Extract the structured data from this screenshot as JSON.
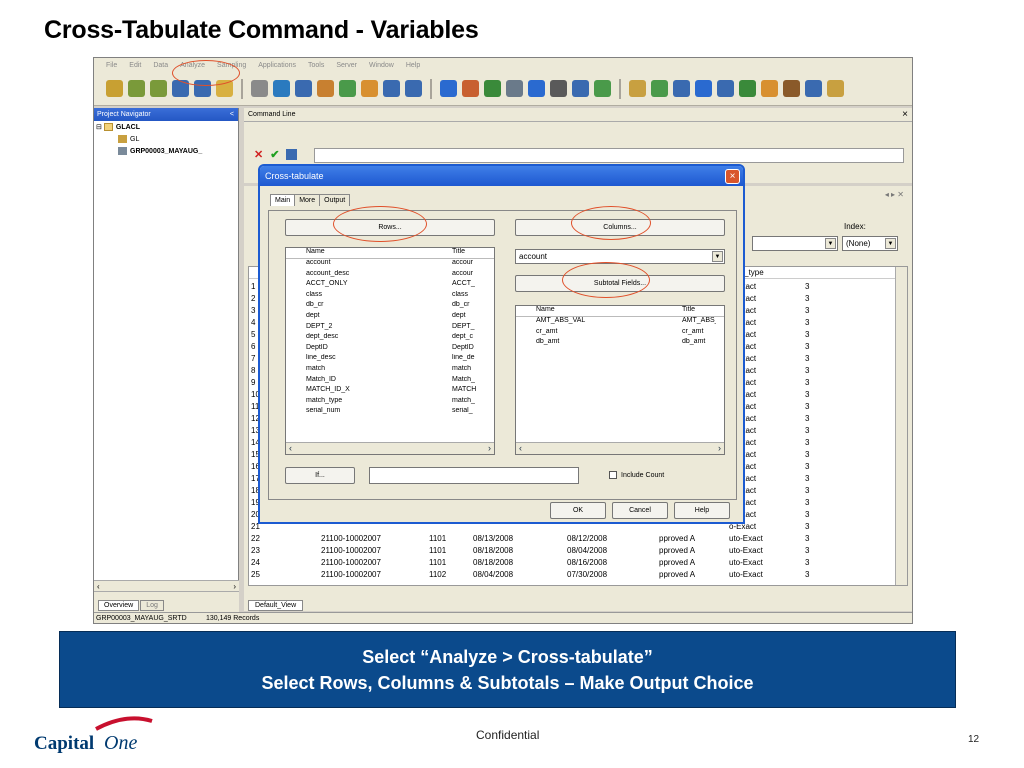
{
  "slide": {
    "title": "Cross-Tabulate Command - Variables",
    "caption_line1": "Select “Analyze > Cross-tabulate”",
    "caption_line2": "Select Rows, Columns & Subtotals – Make Output Choice",
    "confidential": "Confidential",
    "page_number": "12",
    "logo_text_capital": "Capital",
    "logo_text_one": "One",
    "highlight_color": "#e0502a",
    "banner_color": "#0b4a8c"
  },
  "app": {
    "menu": [
      "File",
      "Edit",
      "Data",
      "Analyze",
      "Sampling",
      "Applications",
      "Tools",
      "Server",
      "Window",
      "Help"
    ],
    "toolbar_colors": [
      "#c8a032",
      "#7a9a3a",
      "#7a9a3a",
      "#3a6ab0",
      "#3a6ab0",
      "#d8b040",
      "#8a8a8a",
      "#2a7abf",
      "#3a6ab0",
      "#c88030",
      "#4a9a4a",
      "#d89030",
      "#3a6ab0",
      "#3a6ab0",
      "#2a6ad0",
      "#c86030",
      "#3a8a3a",
      "#6a7a8a",
      "#2a6ad0",
      "#5a5a5a",
      "#3a6ab0",
      "#4a9a4a",
      "#c8a040",
      "#4a9a4a",
      "#3a6ab0",
      "#2a6ad0",
      "#3a6ab0",
      "#3a8a3a",
      "#d89030",
      "#8a5a2a",
      "#3a6ab0",
      "#c8a040"
    ],
    "nav": {
      "title": "Project Navigator",
      "close": "<",
      "tree": [
        "GLACL",
        "GL",
        "GRP00003_MAYAUG_"
      ],
      "tabs": [
        "Overview",
        "Log"
      ]
    },
    "command": {
      "title": "Command Line",
      "close": "×"
    },
    "view": {
      "index_label": "Index:",
      "index_value": "(None)",
      "header_match_type": "atch_type",
      "rows": [
        {
          "n": "1",
          "c1": "",
          "c2": "",
          "c3": "",
          "c4": "",
          "c5": "",
          "c6": "o-Exact",
          "c7": "3"
        },
        {
          "n": "2",
          "c1": "",
          "c2": "",
          "c3": "",
          "c4": "",
          "c5": "",
          "c6": "o-Exact",
          "c7": "3"
        },
        {
          "n": "3",
          "c1": "",
          "c2": "",
          "c3": "",
          "c4": "",
          "c5": "",
          "c6": "o-Exact",
          "c7": "3"
        },
        {
          "n": "4",
          "c1": "",
          "c2": "",
          "c3": "",
          "c4": "",
          "c5": "",
          "c6": "o-Exact",
          "c7": "3"
        },
        {
          "n": "5",
          "c1": "",
          "c2": "",
          "c3": "",
          "c4": "",
          "c5": "",
          "c6": "o-Exact",
          "c7": "3"
        },
        {
          "n": "6",
          "c1": "",
          "c2": "",
          "c3": "",
          "c4": "",
          "c5": "",
          "c6": "o-Exact",
          "c7": "3"
        },
        {
          "n": "7",
          "c1": "",
          "c2": "",
          "c3": "",
          "c4": "",
          "c5": "",
          "c6": "o-Exact",
          "c7": "3"
        },
        {
          "n": "8",
          "c1": "",
          "c2": "",
          "c3": "",
          "c4": "",
          "c5": "",
          "c6": "o-Exact",
          "c7": "3"
        },
        {
          "n": "9",
          "c1": "",
          "c2": "",
          "c3": "",
          "c4": "",
          "c5": "",
          "c6": "o-Exact",
          "c7": "3"
        },
        {
          "n": "10",
          "c1": "",
          "c2": "",
          "c3": "",
          "c4": "",
          "c5": "",
          "c6": "o-Exact",
          "c7": "3"
        },
        {
          "n": "11",
          "c1": "",
          "c2": "",
          "c3": "",
          "c4": "",
          "c5": "",
          "c6": "o-Exact",
          "c7": "3"
        },
        {
          "n": "12",
          "c1": "",
          "c2": "",
          "c3": "",
          "c4": "",
          "c5": "",
          "c6": "o-Exact",
          "c7": "3"
        },
        {
          "n": "13",
          "c1": "",
          "c2": "",
          "c3": "",
          "c4": "",
          "c5": "",
          "c6": "o-Exact",
          "c7": "3"
        },
        {
          "n": "14",
          "c1": "",
          "c2": "",
          "c3": "",
          "c4": "",
          "c5": "",
          "c6": "o-Exact",
          "c7": "3"
        },
        {
          "n": "15",
          "c1": "",
          "c2": "",
          "c3": "",
          "c4": "",
          "c5": "",
          "c6": "o-Exact",
          "c7": "3"
        },
        {
          "n": "16",
          "c1": "",
          "c2": "",
          "c3": "",
          "c4": "",
          "c5": "",
          "c6": "o-Exact",
          "c7": "3"
        },
        {
          "n": "17",
          "c1": "",
          "c2": "",
          "c3": "",
          "c4": "",
          "c5": "",
          "c6": "o-Exact",
          "c7": "3"
        },
        {
          "n": "18",
          "c1": "",
          "c2": "",
          "c3": "",
          "c4": "",
          "c5": "",
          "c6": "o-Exact",
          "c7": "3"
        },
        {
          "n": "19",
          "c1": "",
          "c2": "",
          "c3": "",
          "c4": "",
          "c5": "",
          "c6": "o-Exact",
          "c7": "3"
        },
        {
          "n": "20",
          "c1": "",
          "c2": "",
          "c3": "",
          "c4": "",
          "c5": "",
          "c6": "o-Exact",
          "c7": "3"
        },
        {
          "n": "21",
          "c1": "",
          "c2": "",
          "c3": "",
          "c4": "",
          "c5": "",
          "c6": "o-Exact",
          "c7": "3"
        },
        {
          "n": "22",
          "c1": "21100-10002007",
          "c2": "1101",
          "c3": "08/13/2008",
          "c4": "08/12/2008",
          "c5": "pproved A",
          "c6": "uto-Exact",
          "c7": "3"
        },
        {
          "n": "23",
          "c1": "21100-10002007",
          "c2": "1101",
          "c3": "08/18/2008",
          "c4": "08/04/2008",
          "c5": "pproved A",
          "c6": "uto-Exact",
          "c7": "3"
        },
        {
          "n": "24",
          "c1": "21100-10002007",
          "c2": "1101",
          "c3": "08/18/2008",
          "c4": "08/16/2008",
          "c5": "pproved A",
          "c6": "uto-Exact",
          "c7": "3"
        },
        {
          "n": "25",
          "c1": "21100-10002007",
          "c2": "1102",
          "c3": "08/04/2008",
          "c4": "07/30/2008",
          "c5": "pproved A",
          "c6": "uto-Exact",
          "c7": "3"
        }
      ],
      "tab": "Default_View"
    },
    "status": {
      "table": "GRP00003_MAYAUG_SRTD",
      "records": "130,149 Records"
    }
  },
  "dialog": {
    "title": "Cross-tabulate",
    "close": "×",
    "tabs": [
      "Main",
      "More",
      "Output"
    ],
    "rows_button": "Rows...",
    "columns_button": "Columns...",
    "subtotal_button": "Subtotal Fields...",
    "if_button": "If...",
    "include_count": "Include Count",
    "ok": "OK",
    "cancel": "Cancel",
    "help": "Help",
    "columns_combo": "account",
    "rows_list": {
      "col_name": "Name",
      "col_title": "Title",
      "items": [
        {
          "name": "account",
          "title": "accour"
        },
        {
          "name": "account_desc",
          "title": "accour"
        },
        {
          "name": "ACCT_ONLY",
          "title": "ACCT_"
        },
        {
          "name": "class",
          "title": "class"
        },
        {
          "name": "db_cr",
          "title": "db_cr"
        },
        {
          "name": "dept",
          "title": "dept"
        },
        {
          "name": "DEPT_2",
          "title": "DEPT_"
        },
        {
          "name": "dept_desc",
          "title": "dept_c"
        },
        {
          "name": "DeptID",
          "title": "DeptID"
        },
        {
          "name": "line_desc",
          "title": "line_de"
        },
        {
          "name": "match",
          "title": "match"
        },
        {
          "name": "Match_ID",
          "title": "Match_"
        },
        {
          "name": "MATCH_ID_X",
          "title": "MATCH"
        },
        {
          "name": "match_type",
          "title": "match_"
        },
        {
          "name": "serial_num",
          "title": "serial_"
        }
      ]
    },
    "subtotal_list": {
      "col_name": "Name",
      "col_title": "Title",
      "items": [
        {
          "name": "AMT_ABS_VAL",
          "title": "AMT_ABS_"
        },
        {
          "name": "cr_amt",
          "title": "cr_amt"
        },
        {
          "name": "db_amt",
          "title": "db_amt"
        }
      ]
    }
  }
}
